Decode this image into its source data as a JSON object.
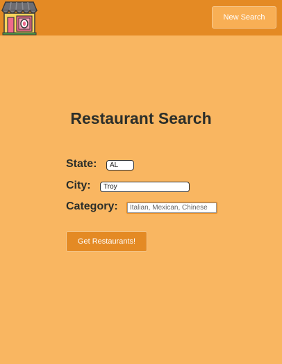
{
  "navbar": {
    "logo_icon": "storefront-icon",
    "new_search_label": "New Search"
  },
  "form": {
    "title": "Restaurant Search",
    "state": {
      "label": "State:",
      "value": "AL"
    },
    "city": {
      "label": "City:",
      "value": "Troy"
    },
    "category": {
      "label": "Category:",
      "placeholder": "Italian, Mexican, Chinese"
    },
    "submit_label": "Get Restaurants!"
  },
  "colors": {
    "background": "#f9b661",
    "navbar": "#e48a24",
    "button": "#e48a24",
    "text": "#2b2e2a"
  }
}
